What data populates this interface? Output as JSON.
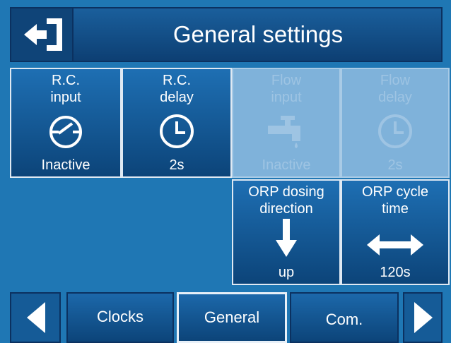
{
  "header": {
    "title": "General settings"
  },
  "tiles": [
    {
      "label": "R.C.\ninput",
      "value": "Inactive",
      "icon": "switch-icon",
      "enabled": true
    },
    {
      "label": "R.C.\ndelay",
      "value": "2s",
      "icon": "clock-icon",
      "enabled": true
    },
    {
      "label": "Flow\ninput",
      "value": "Inactive",
      "icon": "faucet-icon",
      "enabled": false
    },
    {
      "label": "Flow\ndelay",
      "value": "2s",
      "icon": "clock-icon",
      "enabled": false
    },
    {
      "label": "ORP dosing\ndirection",
      "value": "up",
      "icon": "arrow-down-icon",
      "enabled": true
    },
    {
      "label": "ORP cycle\ntime",
      "value": "120s",
      "icon": "double-arrow-icon",
      "enabled": true
    }
  ],
  "nav": {
    "tabs": [
      {
        "label": "Clocks",
        "active": false
      },
      {
        "label": "General",
        "active": true
      },
      {
        "label": "Com.",
        "active": false
      }
    ]
  },
  "colors": {
    "background": "#1f77b4",
    "tile_dark": "#0c4479",
    "disabled": "#7fb2da",
    "text": "#ffffff"
  }
}
